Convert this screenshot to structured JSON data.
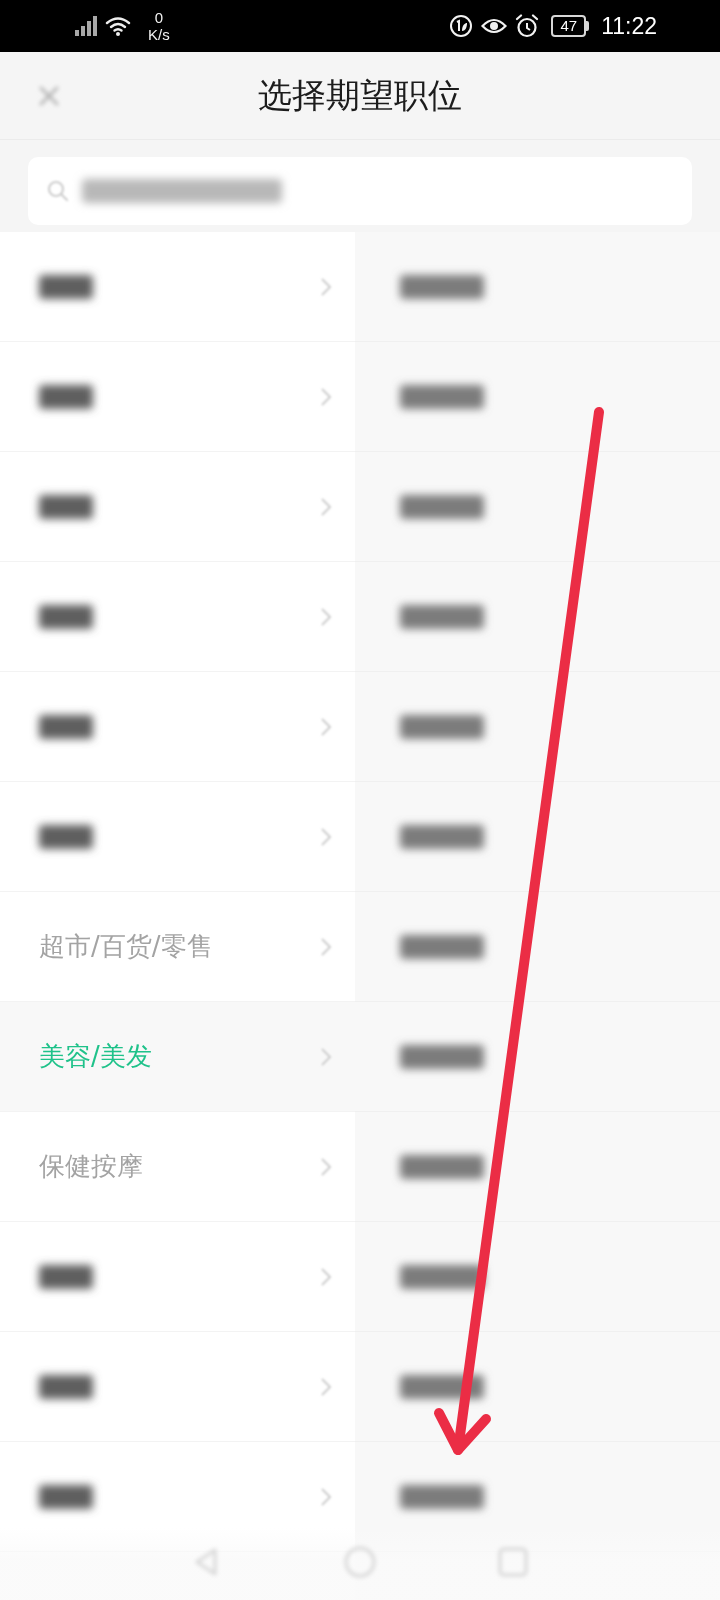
{
  "status_bar": {
    "speed": "0",
    "speed_unit": "K/s",
    "battery": "47",
    "time": "11:22"
  },
  "header": {
    "title": "选择期望职位"
  },
  "categories": [
    {
      "kind": "blurred",
      "selected": false
    },
    {
      "kind": "blurred",
      "selected": false
    },
    {
      "kind": "blurred",
      "selected": false
    },
    {
      "kind": "blurred",
      "selected": false
    },
    {
      "kind": "blurred",
      "selected": false
    },
    {
      "kind": "blurred",
      "selected": false
    },
    {
      "kind": "label",
      "label": "超市/百货/零售",
      "selected": false
    },
    {
      "kind": "label",
      "label": "美容/美发",
      "selected": true
    },
    {
      "kind": "label",
      "label": "保健按摩",
      "selected": false
    },
    {
      "kind": "blurred",
      "selected": false
    },
    {
      "kind": "blurred",
      "selected": false
    },
    {
      "kind": "blurred",
      "selected": false
    }
  ],
  "positions": [
    {
      "kind": "blurred"
    },
    {
      "kind": "blurred"
    },
    {
      "kind": "blurred"
    },
    {
      "kind": "blurred"
    },
    {
      "kind": "blurred"
    },
    {
      "kind": "blurred"
    },
    {
      "kind": "blurred"
    },
    {
      "kind": "blurred"
    },
    {
      "kind": "blurred"
    },
    {
      "kind": "blurred"
    },
    {
      "kind": "blurred"
    },
    {
      "kind": "blurred"
    }
  ],
  "annotation": {
    "kind": "arrow"
  }
}
